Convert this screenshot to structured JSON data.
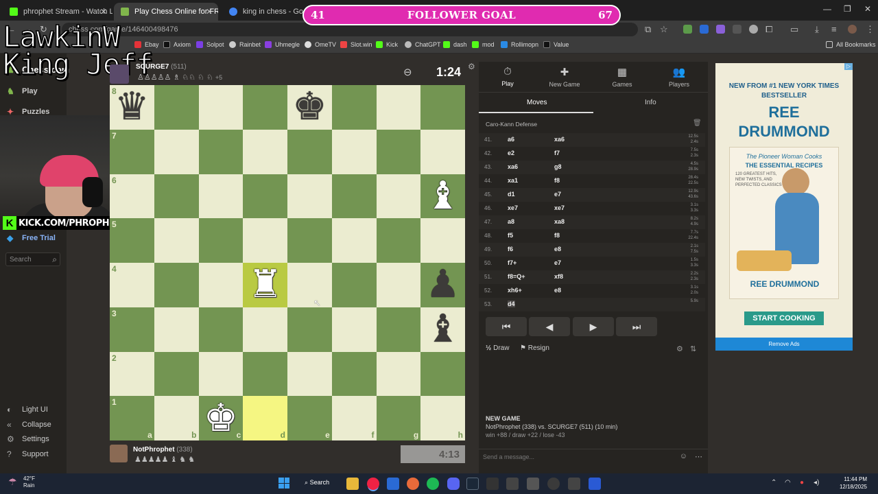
{
  "browser": {
    "tabs": [
      {
        "label": "phrophet Stream - Watch L...",
        "color": "#53fc18"
      },
      {
        "label": "Play Chess Online for FREE",
        "color": "#81b64c"
      },
      {
        "label": "king in chess - Google Search",
        "color": "#4285f4"
      }
    ],
    "url": "chess.com/game/146400498476",
    "bookmarks": [
      "Ebay",
      "Axiom",
      "Solpot",
      "Rainbet",
      "Uhmegle",
      "OmeTV",
      "Slot.win",
      "Kick",
      "ChatGPT",
      "dash",
      "mod",
      "Rollimopn",
      "Value"
    ],
    "all_bookmarks": "All Bookmarks"
  },
  "follower_goal": {
    "current": "41",
    "label": "FOLLOWER GOAL",
    "target": "67",
    "progress_fraction": 0.612
  },
  "overlay": {
    "line1": "LawkinW",
    "line2": "King Jeff",
    "kick_url": "KICK.COM/PHROPHET"
  },
  "sidebar": {
    "logo": "Chess.com",
    "items": [
      "Play",
      "Puzzles"
    ],
    "free_trial": "Free Trial",
    "search_placeholder": "Search",
    "bottom": [
      "Light UI",
      "Collapse",
      "Settings",
      "Support"
    ]
  },
  "game": {
    "top_player": {
      "name": "SCURGE7",
      "rating": "(511)",
      "extra": "+5",
      "clock": "1:24"
    },
    "bottom_player": {
      "name": "NotPhrophet",
      "rating": "(338)",
      "clock": "4:13"
    },
    "ranks": [
      "8",
      "7",
      "6",
      "5",
      "4",
      "3",
      "2",
      "1"
    ],
    "files": [
      "a",
      "b",
      "c",
      "d",
      "e",
      "f",
      "g",
      "h"
    ],
    "pieces": [
      {
        "sq": "a8",
        "glyph": "♛",
        "color": "b"
      },
      {
        "sq": "e8",
        "glyph": "♚",
        "color": "b"
      },
      {
        "sq": "h6",
        "glyph": "♝",
        "color": "w"
      },
      {
        "sq": "d4",
        "glyph": "♜",
        "color": "w"
      },
      {
        "sq": "h4",
        "glyph": "♟",
        "color": "b"
      },
      {
        "sq": "h3",
        "glyph": "♝",
        "color": "b"
      },
      {
        "sq": "c1",
        "glyph": "♚",
        "color": "w"
      }
    ],
    "highlights": [
      "d4",
      "d1"
    ]
  },
  "panel": {
    "tabs": [
      {
        "label": "Play",
        "icon": "⏱"
      },
      {
        "label": "New Game",
        "icon": "✚"
      },
      {
        "label": "Games",
        "icon": "▦"
      },
      {
        "label": "Players",
        "icon": "👥"
      }
    ],
    "subtabs": [
      "Moves",
      "Info"
    ],
    "opening": "Caro-Kann Defense",
    "moves": [
      {
        "n": "41.",
        "w": "a6",
        "b": "xa6",
        "t1": "12.5s",
        "t2": "2.4s"
      },
      {
        "n": "42.",
        "w": "e2",
        "b": "f7",
        "t1": "7.5s",
        "t2": "2.3s"
      },
      {
        "n": "43.",
        "w": "xa6",
        "b": "g8",
        "t1": "4.5s",
        "t2": "28.9s"
      },
      {
        "n": "44.",
        "w": "xa1",
        "b": "f8",
        "t1": "28.4s",
        "t2": "22.5s"
      },
      {
        "n": "45.",
        "w": "d1",
        "b": "e7",
        "t1": "12.9s",
        "t2": "43.6s"
      },
      {
        "n": "46.",
        "w": "xe7",
        "b": "xe7",
        "t1": "3.1s",
        "t2": "3.3s"
      },
      {
        "n": "47.",
        "w": "a8",
        "b": "xa8",
        "t1": "8.2s",
        "t2": "4.9s"
      },
      {
        "n": "48.",
        "w": "f5",
        "b": "f8",
        "t1": "7.7s",
        "t2": "22.4s"
      },
      {
        "n": "49.",
        "w": "f6",
        "b": "e8",
        "t1": "2.1s",
        "t2": "7.5s"
      },
      {
        "n": "50.",
        "w": "f7+",
        "b": "e7",
        "t1": "1.5s",
        "t2": "3.3s"
      },
      {
        "n": "51.",
        "w": "f8=Q+",
        "b": "xf8",
        "t1": "2.2s",
        "t2": "2.3s"
      },
      {
        "n": "52.",
        "w": "xh6+",
        "b": "e8",
        "t1": "3.1s",
        "t2": "2.0s"
      },
      {
        "n": "53.",
        "w": "d4",
        "b": "",
        "t1": "5.9s",
        "t2": ""
      }
    ],
    "nav": [
      "⏮",
      "◀",
      "▶",
      "⏭"
    ],
    "draw": "Draw",
    "resign": "Resign",
    "new_game": {
      "title": "NEW GAME",
      "line1": "NotPhrophet (338) vs. SCURGE7 (511) (10 min)",
      "line2": "win +88 / draw +22 / lose -43"
    },
    "chat_placeholder": "Send a message..."
  },
  "ad": {
    "line1": "NEW FROM #1 NEW YORK TIMES",
    "line2": "BESTSELLER",
    "author": "REE DRUMMOND",
    "book_title": "The Pioneer Woman Cooks",
    "book_subtitle": "THE ESSENTIAL RECIPES",
    "book_blurb": "120 GREATEST HITS, NEW TWISTS, AND PERFECTED CLASSICS",
    "cta": "START COOKING",
    "remove": "Remove Ads"
  },
  "taskbar": {
    "weather_temp": "42°F",
    "weather_desc": "Rain",
    "search": "Search",
    "time": "11:44 PM",
    "date": "12/18/2025"
  }
}
